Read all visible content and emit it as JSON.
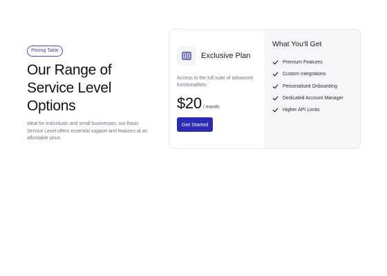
{
  "hero": {
    "badge": "Pricing Table",
    "heading_line1": "Our Range of",
    "heading_line2": "Service Level",
    "heading_line3": "Options",
    "description": "Ideal for individuals and small businesses, our Basic Service Level offers essential support and features at an affordable price."
  },
  "plan": {
    "icon": "building-icon",
    "name": "Exclusive Plan",
    "description": "Access to the full suite of advanced functionalities.",
    "price": "$20",
    "period": "/ month",
    "cta_label": "Get Started"
  },
  "includes": {
    "title": "What You'll Get",
    "features": [
      "Premium Features",
      "Custom Integrations",
      "Personalised Onboarding",
      "Dedicated Account Manager",
      "Higher API Limits"
    ]
  },
  "colors": {
    "accent": "#2b2bb8",
    "badge_border": "#4f46e5",
    "panel_bg": "#f7f7f9"
  }
}
